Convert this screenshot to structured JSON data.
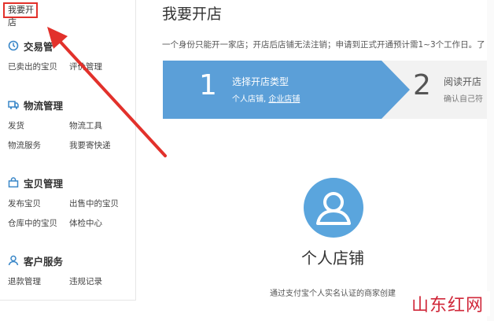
{
  "sidebar": {
    "top_link": "我要开店",
    "sections": [
      {
        "title": "交易管理",
        "title_visible": "交易管",
        "icon": "trade-icon",
        "items": [
          "已卖出的宝贝",
          "评价管理"
        ]
      },
      {
        "title": "物流管理",
        "icon": "logistics-icon",
        "items": [
          "发货",
          "物流工具",
          "物流服务",
          "我要寄快递"
        ]
      },
      {
        "title": "宝贝管理",
        "icon": "goods-icon",
        "items": [
          "发布宝贝",
          "出售中的宝贝",
          "仓库中的宝贝",
          "体检中心"
        ]
      },
      {
        "title": "客户服务",
        "icon": "service-icon",
        "items": [
          "退款管理",
          "违规记录"
        ]
      }
    ]
  },
  "main": {
    "title": "我要开店",
    "notice": "一个身份只能开一家店；开店后店铺无法注销；申请到正式开通预计需1~3个工作日。了",
    "steps": [
      {
        "number": "1",
        "title": "选择开店类型",
        "desc_prefix": "个人店铺, ",
        "desc_link": "企业店铺"
      },
      {
        "number": "2",
        "title": "阅读开店",
        "desc": "确认自己符"
      }
    ],
    "store_type": {
      "icon": "person-icon",
      "title": "个人店铺",
      "desc": "通过支付宝个人实名认证的商家创建"
    }
  },
  "watermark": "山东红网",
  "colors": {
    "accent": "#5b9fd8",
    "highlight_box": "#e2312b",
    "arrow": "#e2312b",
    "step_inactive": "#f2f2f2"
  }
}
